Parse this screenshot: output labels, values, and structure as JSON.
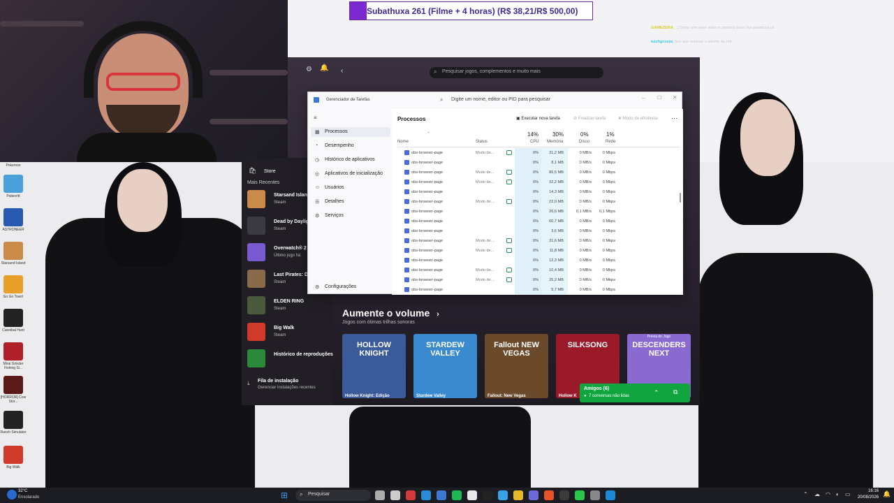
{
  "alert": {
    "text": "Subathuxa 261 (Filme + 4 horas) (R$ 38,21/R$ 500,00)"
  },
  "chat": [
    {
      "user": "GAMEZERA__",
      "message": "Demi com esse valor vc poderia fazer live peladuxa né"
    },
    {
      "user": "luizhgcosta",
      "message": "tem que reiniciar o efeeito da riot"
    }
  ],
  "xbox": {
    "search_placeholder": "Pesquisar jogos, complementos e muito mais",
    "store_label": "Store",
    "recent_header": "Mais Recentes",
    "recent": [
      {
        "title": "Starsand Island",
        "sub": "Steam",
        "color": "#c98a4a"
      },
      {
        "title": "Dead by Daylight",
        "sub": "Steam",
        "color": "#3a3a40"
      },
      {
        "title": "Overwatch® 2",
        "sub": "Último jogo há",
        "color": "#7a5ad0"
      },
      {
        "title": "Last Pirates: Di Together Playt",
        "sub": "Steam",
        "color": "#8a6a4a"
      },
      {
        "title": "ELDEN RING",
        "sub": "Steam",
        "color": "#4a5a3a"
      },
      {
        "title": "Big Walk",
        "sub": "Steam",
        "color": "#d03a2a"
      },
      {
        "title": "Histórico de reproduções",
        "sub": "",
        "color": "#2a8a3a"
      }
    ],
    "install_queue": "Fila de instalação",
    "install_sub": "Gerenciar instalações recentes",
    "section_title": "Aumente o volume",
    "section_sub": "Jogos com ótimas trilhas sonoras",
    "games": [
      {
        "art": "HOLLOW KNIGHT",
        "caption": "Hollow Knight: Edição",
        "color": "#3a5a9a"
      },
      {
        "art": "STARDEW VALLEY",
        "caption": "Stardew Valley",
        "color": "#3a8ad0"
      },
      {
        "art": "Fallout NEW VEGAS",
        "caption": "Fallout: New Vegas",
        "color": "#6a4a2a"
      },
      {
        "art": "SILKSONG",
        "caption": "Hollow K",
        "color": "#9a1a2a"
      },
      {
        "art": "DESCENDERS NEXT",
        "caption": "",
        "color": "#8a6ad0",
        "tag": "Prévia do Jogo"
      }
    ],
    "friends_title": "Amigos (6)",
    "friends_sub": "7 conversas não lidas"
  },
  "taskmanager": {
    "title": "Gerenciador de Tarefas",
    "search_placeholder": "Digite um nome, editor ou PID para pesquisar",
    "nav": [
      {
        "label": "Processos",
        "icon": "▦"
      },
      {
        "label": "Desempenho",
        "icon": "◔"
      },
      {
        "label": "Histórico de aplicativos",
        "icon": "◷"
      },
      {
        "label": "Aplicativos de inicialização",
        "icon": "◎"
      },
      {
        "label": "Usuários",
        "icon": "☺"
      },
      {
        "label": "Detalhes",
        "icon": "☰"
      },
      {
        "label": "Serviços",
        "icon": "⚙"
      }
    ],
    "settings_label": "Configurações",
    "page_title": "Processos",
    "run_task": "Executar nova tarefa",
    "end_task": "Finalizar tarefa",
    "efficiency": "Modo de eficiência",
    "columns": {
      "name": "Nome",
      "status": "Status",
      "cpu_pct": "14%",
      "cpu": "CPU",
      "mem_pct": "30%",
      "mem": "Memória",
      "disk_pct": "0%",
      "disk": "Disco",
      "net_pct": "1%",
      "net": "Rede"
    },
    "rows": [
      {
        "name": "obs-browser-page",
        "status": "Modo de...",
        "leaf": true,
        "cpu": "0%",
        "mem": "31,2 MB",
        "disk": "0 MB/s",
        "net": "0 Mbps"
      },
      {
        "name": "obs-browser-page",
        "status": "",
        "leaf": false,
        "cpu": "0%",
        "mem": "8,1 MB",
        "disk": "0 MB/s",
        "net": "0 Mbps"
      },
      {
        "name": "obs-browser-page",
        "status": "Modo de...",
        "leaf": true,
        "cpu": "0%",
        "mem": "86,5 MB",
        "disk": "0 MB/s",
        "net": "0 Mbps"
      },
      {
        "name": "obs-browser-page",
        "status": "Modo de...",
        "leaf": true,
        "cpu": "0%",
        "mem": "32,2 MB",
        "disk": "0 MB/s",
        "net": "0 Mbps"
      },
      {
        "name": "obs-browser-page",
        "status": "",
        "leaf": false,
        "cpu": "0%",
        "mem": "14,3 MB",
        "disk": "0 MB/s",
        "net": "0 Mbps"
      },
      {
        "name": "obs-browser-page",
        "status": "Modo de...",
        "leaf": true,
        "cpu": "0%",
        "mem": "22,0 MB",
        "disk": "0 MB/s",
        "net": "0 Mbps"
      },
      {
        "name": "obs-browser-page",
        "status": "",
        "leaf": false,
        "cpu": "0%",
        "mem": "26,6 MB",
        "disk": "0,1 MB/s",
        "net": "0,1 Mbps"
      },
      {
        "name": "obs-browser-page",
        "status": "",
        "leaf": false,
        "cpu": "0%",
        "mem": "60,7 MB",
        "disk": "0 MB/s",
        "net": "0 Mbps"
      },
      {
        "name": "obs-browser-page",
        "status": "",
        "leaf": false,
        "cpu": "0%",
        "mem": "3,6 MB",
        "disk": "0 MB/s",
        "net": "0 Mbps"
      },
      {
        "name": "obs-browser-page",
        "status": "Modo de...",
        "leaf": true,
        "cpu": "0%",
        "mem": "31,6 MB",
        "disk": "0 MB/s",
        "net": "0 Mbps"
      },
      {
        "name": "obs-browser-page",
        "status": "Modo de...",
        "leaf": true,
        "cpu": "0%",
        "mem": "11,8 MB",
        "disk": "0 MB/s",
        "net": "0 Mbps"
      },
      {
        "name": "obs-browser-page",
        "status": "",
        "leaf": false,
        "cpu": "0%",
        "mem": "12,3 MB",
        "disk": "0 MB/s",
        "net": "0 Mbps"
      },
      {
        "name": "obs-browser-page",
        "status": "Modo de...",
        "leaf": true,
        "cpu": "0%",
        "mem": "10,4 MB",
        "disk": "0 MB/s",
        "net": "0 Mbps"
      },
      {
        "name": "obs-browser-page",
        "status": "Modo de...",
        "leaf": true,
        "cpu": "0%",
        "mem": "25,2 MB",
        "disk": "0 MB/s",
        "net": "0 Mbps"
      },
      {
        "name": "obs-browser-page",
        "status": "",
        "leaf": false,
        "cpu": "0%",
        "mem": "5,7 MB",
        "disk": "0 MB/s",
        "net": "0 Mbps"
      }
    ]
  },
  "desktop_icons": [
    {
      "label": "Pokemon",
      "color": "#3a7ad0"
    },
    {
      "label": "Palworld",
      "color": "#4aa0d8"
    },
    {
      "label": "ASTRONEER",
      "color": "#2a5ab0"
    },
    {
      "label": "Starsand Island",
      "color": "#c98a4a"
    },
    {
      "label": "Go Go Town!",
      "color": "#e8a02a"
    },
    {
      "label": "Cannibal Hunt",
      "color": "#222"
    },
    {
      "label": "Mirai Grinder Fishing Si...",
      "color": "#b0202a"
    },
    {
      "label": "[HORROR] Cow Stor...",
      "color": "#5a1a1a"
    },
    {
      "label": "Ranch Simulator",
      "color": "#222"
    },
    {
      "label": "Big Walk",
      "color": "#d03a2a"
    }
  ],
  "taskbar": {
    "weather_temp": "32°C",
    "weather_desc": "Ensolarado",
    "search_label": "Pesquisar",
    "time": "16:16",
    "date": "20/08/2026"
  }
}
